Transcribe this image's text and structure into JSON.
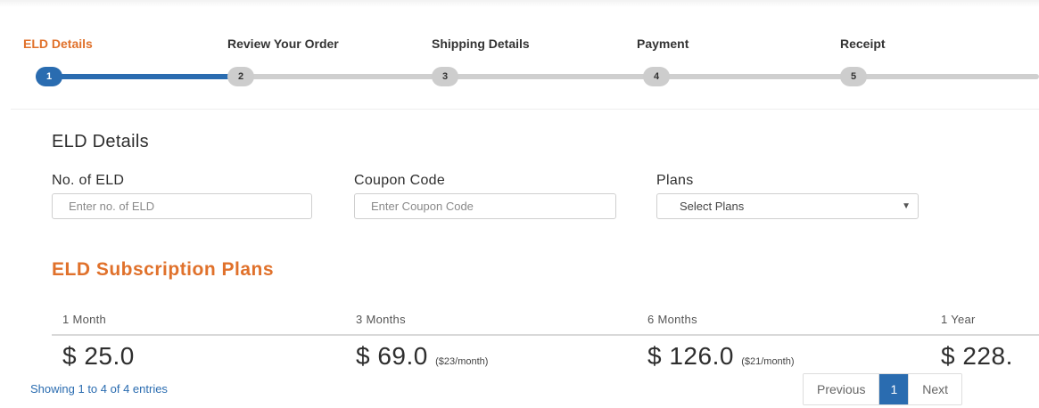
{
  "stepper": {
    "steps": [
      {
        "label": "ELD Details",
        "num": "1"
      },
      {
        "label": "Review Your Order",
        "num": "2"
      },
      {
        "label": "Shipping Details",
        "num": "3"
      },
      {
        "label": "Payment",
        "num": "4"
      },
      {
        "label": "Receipt",
        "num": "5"
      }
    ],
    "active_step": 1
  },
  "form": {
    "title": "ELD Details",
    "no_of_eld": {
      "label": "No. of ELD",
      "placeholder": "Enter no. of ELD",
      "value": ""
    },
    "coupon": {
      "label": "Coupon Code",
      "placeholder": "Enter Coupon Code",
      "value": ""
    },
    "plans": {
      "label": "Plans",
      "selected": "Select Plans"
    }
  },
  "subscription": {
    "title": "ELD Subscription Plans",
    "plans": [
      {
        "name": "1 Month",
        "price": "$ 25.0",
        "per_month": ""
      },
      {
        "name": "3 Months",
        "price": "$ 69.0",
        "per_month": "($23/month)"
      },
      {
        "name": "6 Months",
        "price": "$ 126.0",
        "per_month": "($21/month)"
      },
      {
        "name": "1 Year",
        "price": "$ 228.",
        "per_month": ""
      }
    ]
  },
  "table_footer": {
    "showing": "Showing 1 to 4 of 4 entries",
    "pagination": {
      "previous": "Previous",
      "current": "1",
      "next": "Next"
    }
  },
  "colors": {
    "accent": "#e0712b",
    "primary": "#2a6cb0",
    "track": "#cfcfcf"
  }
}
